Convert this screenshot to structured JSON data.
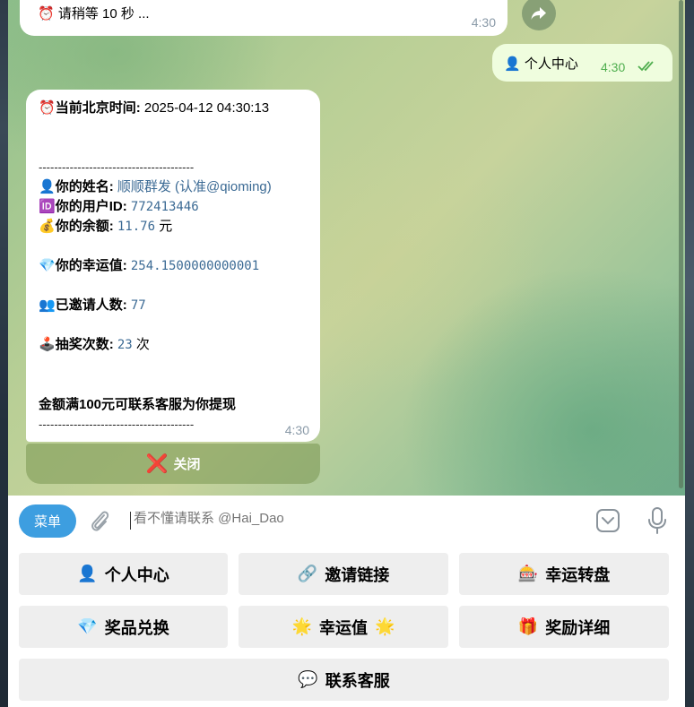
{
  "messages": {
    "wait": {
      "icon": "alarm-clock-icon",
      "text": "请稍等 10 秒 ...",
      "time": "4:30"
    },
    "outgoing": {
      "icon": "user-icon",
      "text": "个人中心",
      "time": "4:30",
      "status": "read-double-check-icon"
    },
    "profile": {
      "time_label": "当前北京时间:",
      "time_value": "2025-04-12 04:30:13",
      "separator": "----------------------------------------",
      "name_label": "你的姓名:",
      "name_value": "顺顺群发 (认准@qioming)",
      "uid_label": "你的用户ID:",
      "uid_value": "772413446",
      "balance_label": "你的余额:",
      "balance_value": "11.76",
      "balance_unit": "元",
      "lucky_label": "你的幸运值:",
      "lucky_value": "254.1500000000001",
      "invite_label": "已邀请人数:",
      "invite_value": "77",
      "draw_label": "抽奖次数:",
      "draw_value": "23",
      "draw_unit": "次",
      "notice": "金额满100元可联系客服为你提现",
      "time": "4:30"
    },
    "close_button": "关闭"
  },
  "composer": {
    "menu_label": "菜单",
    "placeholder": "看不懂请联系 @Hai_Dao"
  },
  "keyboard": [
    {
      "id": "personal",
      "icon": "👤",
      "label": "个人中心"
    },
    {
      "id": "invite",
      "icon": "🔗",
      "label": "邀请链接"
    },
    {
      "id": "wheel",
      "icon": "🎰",
      "label": "幸运转盘"
    },
    {
      "id": "exchange",
      "icon": "💎",
      "label": "奖品兑换"
    },
    {
      "id": "lucky",
      "icon": "🌟",
      "label": "幸运值",
      "icon_after": "🌟"
    },
    {
      "id": "rewards",
      "icon": "🎁",
      "label": "奖励详细"
    },
    {
      "id": "support",
      "icon": "💬",
      "label": "联系客服"
    }
  ],
  "colors": {
    "accent": "#3d9ee0",
    "outgoing_bubble": "#effdde",
    "link": "#3b6a94"
  }
}
